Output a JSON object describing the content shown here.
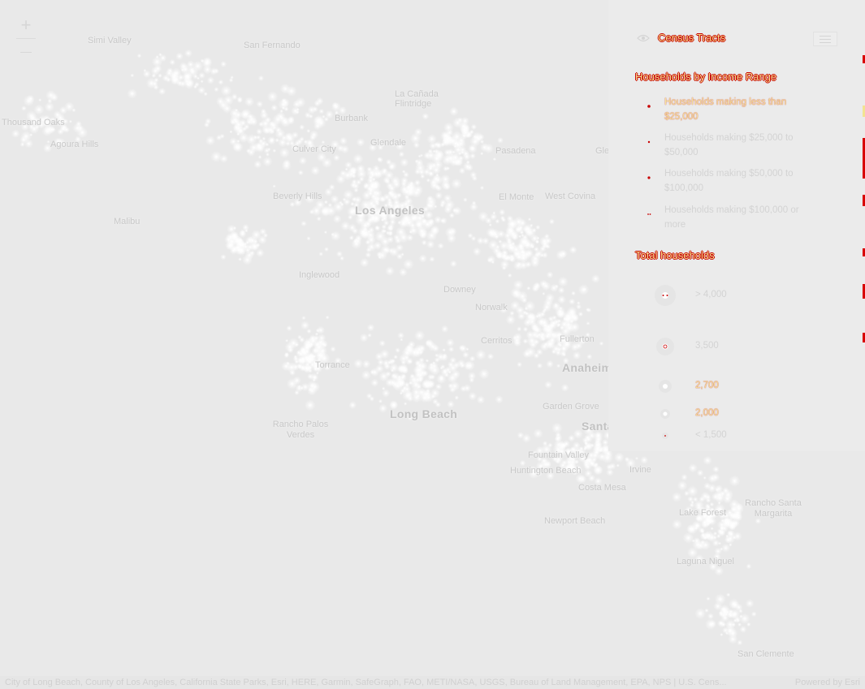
{
  "map": {
    "zoom_in_label": "+",
    "zoom_out_label": "—",
    "places": [
      {
        "name": "Simi Valley",
        "size": "normal"
      },
      {
        "name": "San Fernando",
        "size": "normal"
      },
      {
        "name": "Thousand Oaks",
        "size": "normal"
      },
      {
        "name": "Agoura Hills",
        "size": "normal"
      },
      {
        "name": "La Cañada Flintridge",
        "size": "normal"
      },
      {
        "name": "Glendale",
        "size": "normal"
      },
      {
        "name": "Burbank",
        "size": "normal"
      },
      {
        "name": "Pasadena",
        "size": "normal"
      },
      {
        "name": "Culver City",
        "size": "normal"
      },
      {
        "name": "Beverly Hills",
        "size": "normal"
      },
      {
        "name": "Malibu",
        "size": "normal"
      },
      {
        "name": "Los Angeles",
        "size": "big"
      },
      {
        "name": "El Monte",
        "size": "normal"
      },
      {
        "name": "West Covina",
        "size": "normal"
      },
      {
        "name": "Inglewood",
        "size": "normal"
      },
      {
        "name": "Downey",
        "size": "normal"
      },
      {
        "name": "Norwalk",
        "size": "normal"
      },
      {
        "name": "Torrance",
        "size": "normal"
      },
      {
        "name": "Cerritos",
        "size": "normal"
      },
      {
        "name": "Fullerton",
        "size": "normal"
      },
      {
        "name": "Anaheim",
        "size": "big"
      },
      {
        "name": "Long Beach",
        "size": "big"
      },
      {
        "name": "Garden Grove",
        "size": "normal"
      },
      {
        "name": "Santa Ana",
        "size": "big"
      },
      {
        "name": "Rancho Palos Verdes",
        "size": "normal"
      },
      {
        "name": "Fountain Valley",
        "size": "normal"
      },
      {
        "name": "Huntington Beach",
        "size": "normal"
      },
      {
        "name": "Costa Mesa",
        "size": "normal"
      },
      {
        "name": "Newport Beach",
        "size": "normal"
      },
      {
        "name": "Irvine",
        "size": "normal"
      },
      {
        "name": "Lake Forest",
        "size": "normal"
      },
      {
        "name": "Rancho Santa Margarita",
        "size": "normal"
      },
      {
        "name": "Laguna Niguel",
        "size": "normal"
      },
      {
        "name": "San Clemente",
        "size": "normal"
      },
      {
        "name": "Gle",
        "size": "normal"
      }
    ]
  },
  "panel": {
    "layer_title": "Census Tracts",
    "eye_icon": "eye-icon",
    "menu_icon": "menu-icon",
    "category_heading": "Households by Income Range",
    "categories": [
      {
        "label": "Households making less than $25,000",
        "color": "#c80000"
      },
      {
        "label": "Households making $25,000 to $50,000",
        "color": "#c80000"
      },
      {
        "label": "Households making $50,000 to $100,000",
        "color": "#c80000"
      },
      {
        "label": "Households making $100,000 or more",
        "color": "#c80000"
      }
    ],
    "size_heading": "Total households",
    "sizes": [
      {
        "label": "> 4,000",
        "value": 4000
      },
      {
        "label": "3,500",
        "value": 3500
      },
      {
        "label": "2,700",
        "value": 2700
      },
      {
        "label": "2,000",
        "value": 2000
      },
      {
        "label": "< 1,500",
        "value": 1500
      }
    ]
  },
  "attribution": {
    "text": "City of Long Beach, County of Los Angeles, California State Parks, Esri, HERE, Garmin, SafeGraph, FAO, METI/NASA, USGS, Bureau of Land Management, EPA, NPS | U.S. Cens...",
    "powered_by": "Powered by Esri"
  },
  "colors": {
    "background": "#e9e9e9",
    "dot_glow": "#ffffff",
    "highlight_text": "#f2e391",
    "highlight_outline": "#c80000"
  }
}
